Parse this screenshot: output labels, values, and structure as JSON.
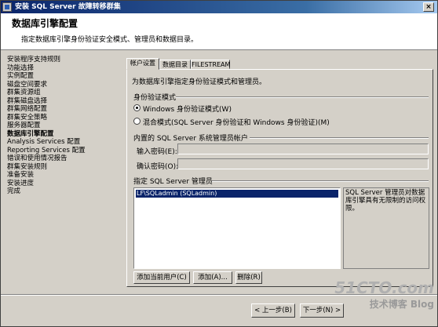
{
  "window": {
    "title": "安装 SQL Server 故障转移群集"
  },
  "header": {
    "title": "数据库引擎配置",
    "subtitle": "指定数据库引擎身份验证安全模式、管理员和数据目录。"
  },
  "sidebar": {
    "items": [
      {
        "label": "安装程序支持规则"
      },
      {
        "label": "功能选择"
      },
      {
        "label": "实例配置"
      },
      {
        "label": "磁盘空间要求"
      },
      {
        "label": "群集资源组"
      },
      {
        "label": "群集磁盘选择"
      },
      {
        "label": "群集网络配置"
      },
      {
        "label": "群集安全策略"
      },
      {
        "label": "服务器配置"
      },
      {
        "label": "数据库引擎配置"
      },
      {
        "label": "Analysis Services 配置"
      },
      {
        "label": "Reporting Services 配置"
      },
      {
        "label": "错误和使用情况报告"
      },
      {
        "label": "群集安装规则"
      },
      {
        "label": "准备安装"
      },
      {
        "label": "安装进度"
      },
      {
        "label": "完成"
      }
    ]
  },
  "tabs": [
    {
      "label": "帐户设置"
    },
    {
      "label": "数据目录"
    },
    {
      "label": "FILESTREAM"
    }
  ],
  "account": {
    "intro": "为数据库引擎指定身份验证模式和管理员。",
    "auth_group": "身份验证模式",
    "radio_windows": "Windows 身份验证模式(W)",
    "radio_mixed": "混合模式(SQL Server 身份验证和 Windows 身份验证)(M)",
    "builtin_group": "内置的 SQL Server 系统管理员帐户",
    "password_label": "输入密码(E):",
    "confirm_label": "确认密码(O):",
    "admins_group": "指定 SQL Server 管理员",
    "admins": [
      "LF\\SQLadmin (SQLadmin)"
    ],
    "admins_note": "SQL Server 管理员对数据库引擎具有无限制的访问权限。",
    "btn_add_current": "添加当前用户(C)",
    "btn_add": "添加(A)...",
    "btn_remove": "删除(R)"
  },
  "footer": {
    "back": "< 上一步(B)",
    "next": "下一步(N) >"
  },
  "watermark": {
    "line1": "51CTO.com",
    "line2": "技术博客 Blog"
  }
}
